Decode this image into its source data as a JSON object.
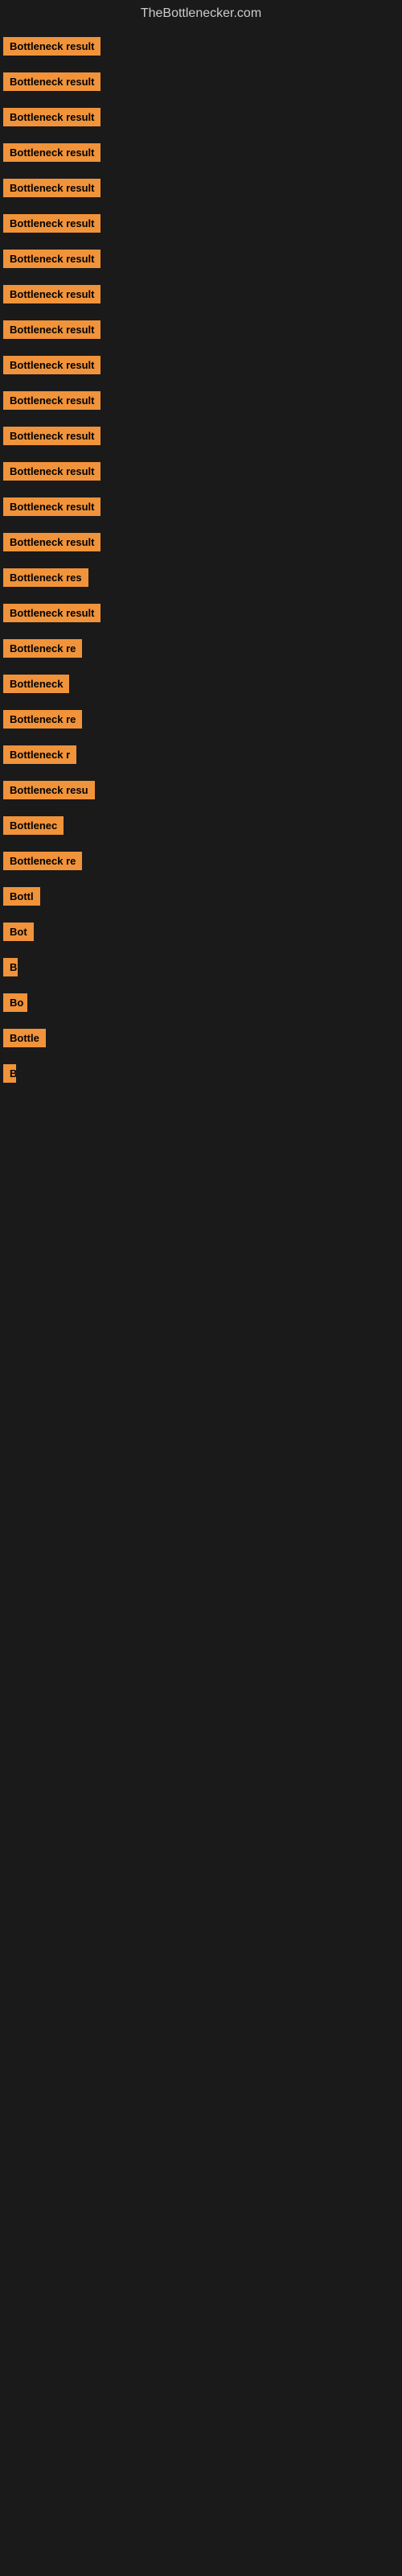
{
  "site": {
    "title": "TheBottlenecker.com"
  },
  "items": [
    {
      "label": "Bottleneck result",
      "width": 140
    },
    {
      "label": "Bottleneck result",
      "width": 140
    },
    {
      "label": "Bottleneck result",
      "width": 140
    },
    {
      "label": "Bottleneck result",
      "width": 140
    },
    {
      "label": "Bottleneck result",
      "width": 140
    },
    {
      "label": "Bottleneck result",
      "width": 140
    },
    {
      "label": "Bottleneck result",
      "width": 140
    },
    {
      "label": "Bottleneck result",
      "width": 140
    },
    {
      "label": "Bottleneck result",
      "width": 140
    },
    {
      "label": "Bottleneck result",
      "width": 140
    },
    {
      "label": "Bottleneck result",
      "width": 140
    },
    {
      "label": "Bottleneck result",
      "width": 140
    },
    {
      "label": "Bottleneck result",
      "width": 140
    },
    {
      "label": "Bottleneck result",
      "width": 140
    },
    {
      "label": "Bottleneck result",
      "width": 140
    },
    {
      "label": "Bottleneck res",
      "width": 115
    },
    {
      "label": "Bottleneck result",
      "width": 140
    },
    {
      "label": "Bottleneck re",
      "width": 105
    },
    {
      "label": "Bottleneck",
      "width": 88
    },
    {
      "label": "Bottleneck re",
      "width": 105
    },
    {
      "label": "Bottleneck r",
      "width": 95
    },
    {
      "label": "Bottleneck resu",
      "width": 120
    },
    {
      "label": "Bottlenec",
      "width": 82
    },
    {
      "label": "Bottleneck re",
      "width": 100
    },
    {
      "label": "Bottl",
      "width": 55
    },
    {
      "label": "Bot",
      "width": 42
    },
    {
      "label": "B",
      "width": 18
    },
    {
      "label": "Bo",
      "width": 30
    },
    {
      "label": "Bottle",
      "width": 58
    },
    {
      "label": "B",
      "width": 15
    }
  ]
}
